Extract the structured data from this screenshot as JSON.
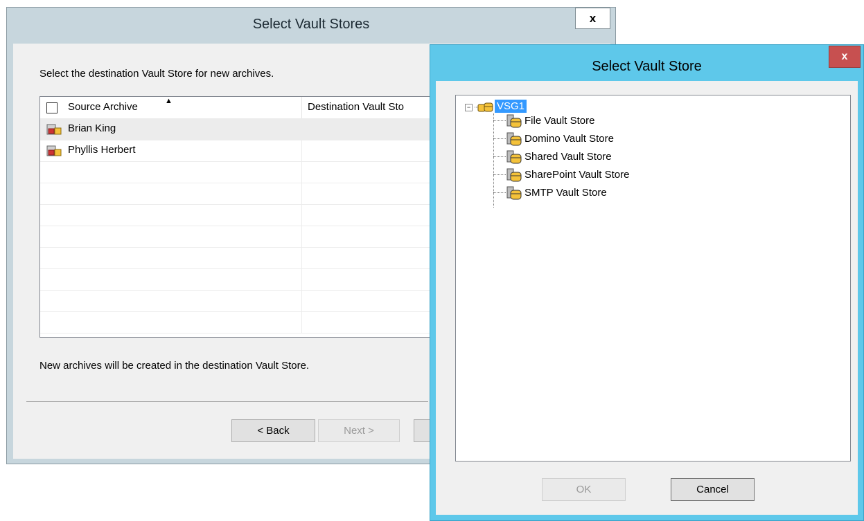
{
  "back_window": {
    "title": "Select Vault Stores",
    "close_glyph": "x",
    "instruction": "Select the destination Vault Store for new archives.",
    "list": {
      "col_source": "Source Archive",
      "col_destination": "Destination Vault Sto",
      "rows": [
        {
          "name": "Brian King",
          "destination": ""
        },
        {
          "name": "Phyllis Herbert",
          "destination": ""
        }
      ]
    },
    "status_text": "New archives will be created in the destination Vault Store.",
    "buttons": {
      "back": "< Back",
      "next": "Next >"
    }
  },
  "front_window": {
    "title": "Select Vault Store",
    "close_glyph": "x",
    "tree": {
      "root": {
        "label": "VSG1",
        "expander": "−"
      },
      "children": [
        "File Vault Store",
        "Domino Vault Store",
        "Shared Vault Store",
        "SharePoint Vault Store",
        "SMTP Vault Store"
      ]
    },
    "buttons": {
      "ok": "OK",
      "cancel": "Cancel"
    }
  },
  "colors": {
    "front_frame": "#5ec8ea",
    "back_frame": "#c7d6dd",
    "close_red": "#c75050",
    "selection": "#3399ff"
  }
}
